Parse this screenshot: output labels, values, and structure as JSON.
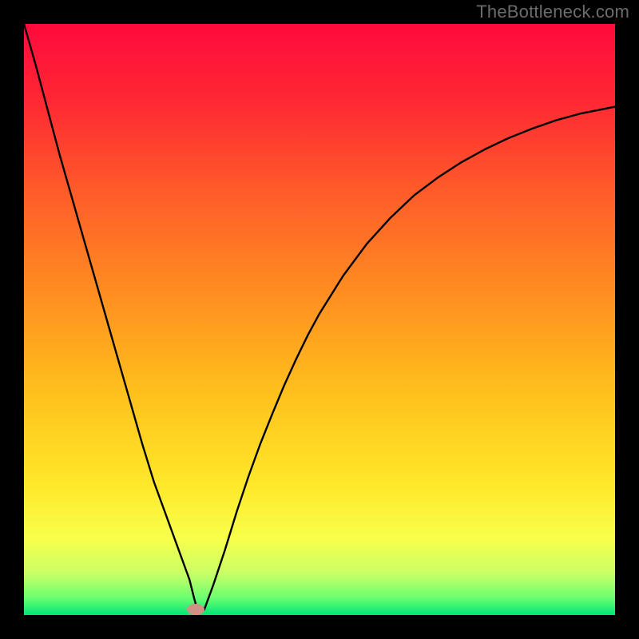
{
  "watermark": "TheBottleneck.com",
  "chart_data": {
    "type": "line",
    "title": "",
    "xlabel": "",
    "ylabel": "",
    "xlim": [
      0,
      100
    ],
    "ylim": [
      0,
      100
    ],
    "grid": false,
    "legend": false,
    "background_gradient_top": "#ff0a3c",
    "background_gradient_bottom": "#00e676",
    "marker": {
      "x": 29,
      "y": 1,
      "color": "#cf9285"
    },
    "series": [
      {
        "name": "curve",
        "color": "#000000",
        "x": [
          0,
          2,
          4,
          6,
          8,
          10,
          12,
          14,
          16,
          18,
          20,
          22,
          24,
          26,
          28,
          28.8,
          29.5,
          30.5,
          32,
          34,
          36,
          38,
          40,
          42,
          44,
          46,
          48,
          50,
          54,
          58,
          62,
          66,
          70,
          74,
          78,
          82,
          86,
          90,
          94,
          98,
          100
        ],
        "y": [
          100,
          93,
          85.5,
          78,
          71,
          64,
          57,
          50,
          43,
          36,
          29,
          22.5,
          17,
          11.5,
          6,
          2.8,
          0.3,
          0.9,
          5,
          11,
          17.5,
          23.5,
          29,
          34,
          38.8,
          43.2,
          47.3,
          51,
          57.4,
          62.8,
          67.2,
          71,
          74,
          76.6,
          78.8,
          80.7,
          82.3,
          83.7,
          84.8,
          85.6,
          86
        ]
      }
    ]
  }
}
